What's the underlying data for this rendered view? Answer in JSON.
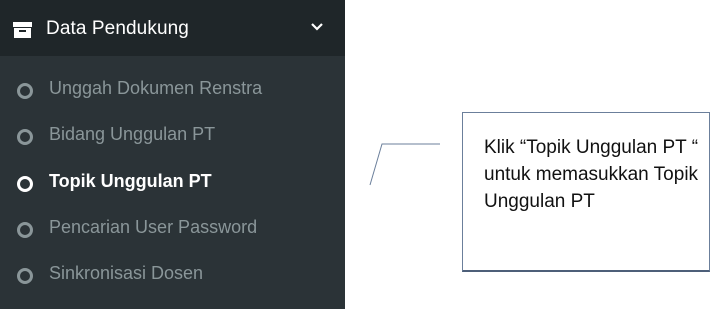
{
  "sidebar": {
    "header": {
      "label": "Data Pendukung",
      "icon": "archive-icon",
      "chevron": "chevron-down-icon"
    },
    "items": [
      {
        "label": "Unggah Dokumen Renstra",
        "icon": "circle-bullet-icon",
        "active": false
      },
      {
        "label": "Bidang Unggulan PT",
        "icon": "circle-bullet-icon",
        "active": false
      },
      {
        "label": "Topik Unggulan PT",
        "icon": "circle-bullet-icon",
        "active": true
      },
      {
        "label": "Pencarian User Password",
        "icon": "circle-bullet-icon",
        "active": false
      },
      {
        "label": "Sinkronisasi Dosen",
        "icon": "circle-bullet-icon",
        "active": false
      }
    ]
  },
  "callout": {
    "text": "Klik “Topik Unggulan PT “ untuk memasukkan Topik Unggulan PT"
  },
  "colors": {
    "sidebar_bg": "#2b3337",
    "header_bg": "#1f2629",
    "inactive_text": "#8a9699",
    "active_text": "#ffffff",
    "callout_border": "#6b7f9b"
  }
}
